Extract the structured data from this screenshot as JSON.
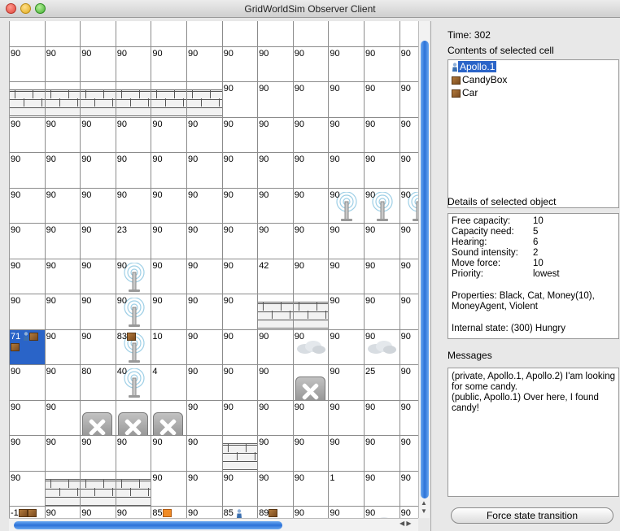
{
  "window": {
    "title": "GridWorldSim Observer Client"
  },
  "colors": {
    "selection": "#2a64c8",
    "scroll_thumb": "#2c72d8"
  },
  "grid": {
    "rows": [
      [
        "",
        "",
        "",
        "",
        "",
        "",
        "",
        "",
        "",
        "",
        "",
        ""
      ],
      [
        "90",
        "90",
        "90",
        "90",
        "90",
        "90",
        "90",
        "90",
        "90",
        "90",
        "90",
        "90"
      ],
      [
        "W",
        "W",
        "W",
        "W",
        "W",
        "W",
        "90",
        "90",
        "90",
        "90",
        "90",
        "90"
      ],
      [
        "90",
        "90",
        "90",
        "90",
        "90",
        "90",
        "90",
        "90",
        "90",
        "90",
        "90",
        "90"
      ],
      [
        "90",
        "90",
        "90",
        "90",
        "90",
        "90",
        "90",
        "90",
        "90",
        "90",
        "90",
        "90"
      ],
      [
        "90",
        "90",
        "90",
        "90",
        "90",
        "90",
        "90",
        "90",
        "90",
        "90",
        "90",
        "90"
      ],
      [
        "90",
        "90",
        "90",
        "23",
        "90",
        "90",
        "90",
        "90",
        "90",
        "90",
        "90",
        "90"
      ],
      [
        "90",
        "90",
        "90",
        "90",
        "90",
        "90",
        "90",
        "42",
        "90",
        "90",
        "90",
        "90"
      ],
      [
        "90",
        "90",
        "90",
        "90",
        "90",
        "90",
        "90",
        "W",
        "W",
        "90",
        "90",
        "90"
      ],
      [
        "71",
        "90",
        "90",
        "83",
        "10",
        "90",
        "90",
        "90",
        "90",
        "90",
        "90",
        "90"
      ],
      [
        "90",
        "90",
        "80",
        "40",
        "4",
        "90",
        "90",
        "90",
        "X",
        "90",
        "25",
        "90"
      ],
      [
        "90",
        "90",
        "X",
        "X",
        "X",
        "90",
        "90",
        "90",
        "90",
        "90",
        "90",
        "90"
      ],
      [
        "90",
        "90",
        "90",
        "90",
        "90",
        "90",
        "W",
        "90",
        "90",
        "90",
        "90",
        "90"
      ],
      [
        "90",
        "W",
        "W",
        "W",
        "90",
        "90",
        "90",
        "90",
        "90",
        "1",
        "90",
        "90"
      ],
      [
        "-1",
        "90",
        "90",
        "90",
        "85",
        "90",
        "85",
        "89",
        "90",
        "90",
        "90",
        "90"
      ]
    ]
  },
  "panel": {
    "time_label": "Time: 302",
    "contents_label": "Contents of selected cell",
    "contents": [
      {
        "name": "Apollo.1",
        "icon": "person-icon"
      },
      {
        "name": "CandyBox",
        "icon": "box-icon"
      },
      {
        "name": "Car",
        "icon": "box-icon"
      }
    ],
    "details_label": "Details of selected object",
    "details": [
      {
        "k": "Free capacity:",
        "v": "10"
      },
      {
        "k": "Capacity need:",
        "v": "5"
      },
      {
        "k": "Hearing:",
        "v": "6"
      },
      {
        "k": "Sound intensity:",
        "v": "2"
      },
      {
        "k": "Move force:",
        "v": "10"
      },
      {
        "k": "Priority:",
        "v": "lowest"
      }
    ],
    "properties": "Properties: Black, Cat, Money(10), MoneyAgent, Violent",
    "internal_state": "Internal state: (300) Hungry",
    "messages_label": "Messages",
    "messages": "(private, Apollo.1, Apollo.2) I'am looking for some candy.\n(public, Apollo.1) Over here, I found candy!",
    "force_button": "Force state transition"
  }
}
